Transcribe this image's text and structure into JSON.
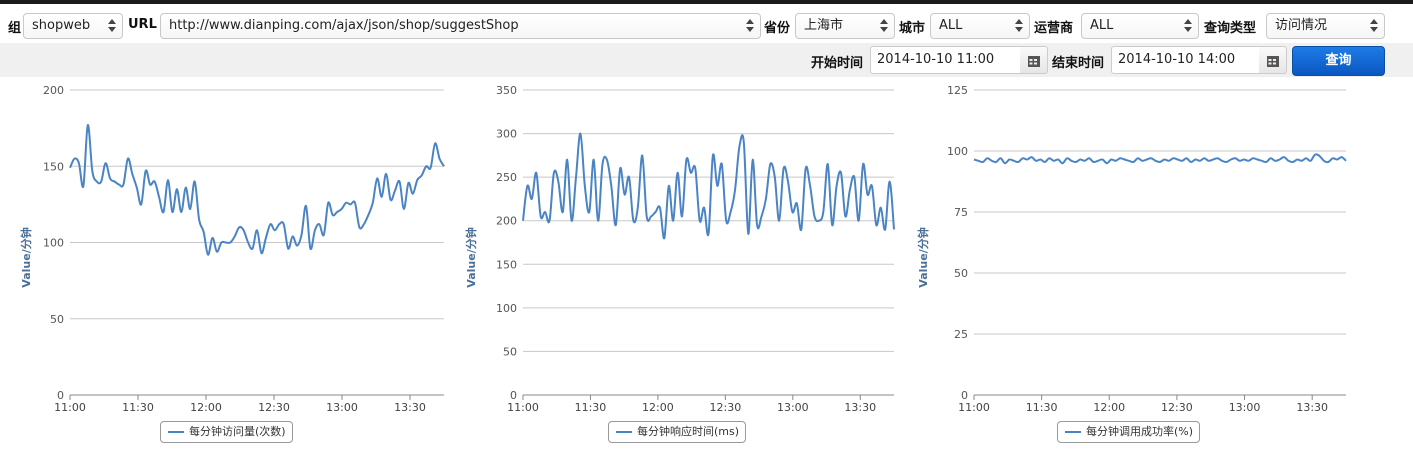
{
  "filters": {
    "group": {
      "label": "组",
      "value": "shopweb"
    },
    "url": {
      "label": "URL",
      "value": "http://www.dianping.com/ajax/json/shop/suggestShop"
    },
    "province": {
      "label": "省份",
      "value": "上海市"
    },
    "city": {
      "label": "城市",
      "value": "ALL"
    },
    "carrier": {
      "label": "运营商",
      "value": "ALL"
    },
    "query_type": {
      "label": "查询类型",
      "value": "访问情况"
    }
  },
  "time": {
    "start_label": "开始时间",
    "start_value": "2014-10-10 11:00",
    "end_label": "结束时间",
    "end_value": "2014-10-10 14:00",
    "query_label": "查询"
  },
  "colors": {
    "line": "#4a84c4",
    "accent": "#0b57c2"
  },
  "chart_data": [
    {
      "type": "line",
      "ylabel": "Value/分钟",
      "ylim": [
        0,
        200
      ],
      "yticks": [
        "0",
        "50",
        "100",
        "150",
        "200"
      ],
      "xticks": [
        "11:00",
        "11:30",
        "12:00",
        "12:30",
        "13:00",
        "13:30"
      ],
      "xlim_minutes": [
        0,
        165
      ],
      "legend": "每分钟访问量(次数)",
      "series": [
        {
          "name": "每分钟访问量(次数)",
          "values": [
            149,
            155,
            152,
            137,
            177,
            147,
            140,
            140,
            152,
            142,
            140,
            138,
            138,
            155,
            145,
            136,
            125,
            147,
            138,
            140,
            130,
            120,
            141,
            120,
            135,
            120,
            136,
            122,
            140,
            115,
            107,
            92,
            103,
            94,
            100,
            100,
            100,
            104,
            110,
            108,
            100,
            96,
            108,
            93,
            103,
            112,
            108,
            112,
            112,
            96,
            104,
            98,
            105,
            124,
            96,
            108,
            112,
            105,
            126,
            118,
            120,
            122,
            126,
            125,
            126,
            110,
            112,
            118,
            126,
            142,
            130,
            145,
            128,
            134,
            140,
            122,
            139,
            132,
            141,
            144,
            150,
            149,
            165,
            155,
            150
          ]
        }
      ]
    },
    {
      "type": "line",
      "ylabel": "Value/分钟",
      "ylim": [
        0,
        350
      ],
      "yticks": [
        "0",
        "50",
        "100",
        "150",
        "200",
        "250",
        "300",
        "350"
      ],
      "xticks": [
        "11:00",
        "11:30",
        "12:00",
        "12:30",
        "13:00",
        "13:30"
      ],
      "xlim_minutes": [
        0,
        165
      ],
      "legend": "每分钟响应时间(ms)",
      "series": [
        {
          "name": "每分钟响应时间(ms)",
          "values": [
            200,
            240,
            225,
            255,
            205,
            210,
            200,
            255,
            245,
            210,
            270,
            200,
            250,
            300,
            240,
            210,
            270,
            200,
            265,
            270,
            240,
            195,
            260,
            230,
            250,
            200,
            215,
            275,
            205,
            205,
            210,
            215,
            180,
            240,
            200,
            255,
            205,
            270,
            255,
            260,
            200,
            215,
            185,
            275,
            240,
            265,
            200,
            210,
            235,
            285,
            290,
            185,
            270,
            195,
            205,
            225,
            265,
            250,
            200,
            260,
            245,
            210,
            220,
            190,
            260,
            240,
            205,
            200,
            210,
            265,
            195,
            240,
            255,
            205,
            235,
            250,
            200,
            265,
            230,
            240,
            195,
            215,
            190,
            245,
            190
          ]
        }
      ]
    },
    {
      "type": "line",
      "ylabel": "Value/分钟",
      "ylim": [
        0,
        125
      ],
      "yticks": [
        "0",
        "25",
        "50",
        "75",
        "100",
        "125"
      ],
      "xticks": [
        "11:00",
        "11:30",
        "12:00",
        "12:30",
        "13:00",
        "13:30"
      ],
      "xlim_minutes": [
        0,
        165
      ],
      "legend": "每分钟调用成功率(%)",
      "series": [
        {
          "name": "每分钟调用成功率(%)",
          "values": [
            96.5,
            96,
            95.5,
            97,
            96,
            95.5,
            97,
            95,
            96.5,
            96,
            95.5,
            97,
            96.5,
            97.5,
            96,
            96.5,
            95.5,
            97,
            96,
            96.5,
            95,
            97,
            96,
            95.5,
            96.5,
            96,
            97,
            95.5,
            96,
            96.5,
            95,
            96.5,
            96,
            97,
            96.5,
            96,
            95.5,
            97,
            96,
            96.5,
            97,
            96,
            95.5,
            96.5,
            96,
            97,
            96.5,
            96,
            97,
            95.5,
            96.5,
            96,
            97,
            96,
            96.5,
            97,
            96,
            95.5,
            96.5,
            97,
            96,
            96.5,
            96,
            97,
            96.5,
            96,
            95.5,
            97,
            96,
            96.5,
            97.5,
            96,
            95.5,
            96.5,
            96,
            97,
            96,
            98.5,
            98,
            96,
            95.5,
            97,
            96.5,
            97.5,
            96
          ]
        }
      ]
    }
  ]
}
